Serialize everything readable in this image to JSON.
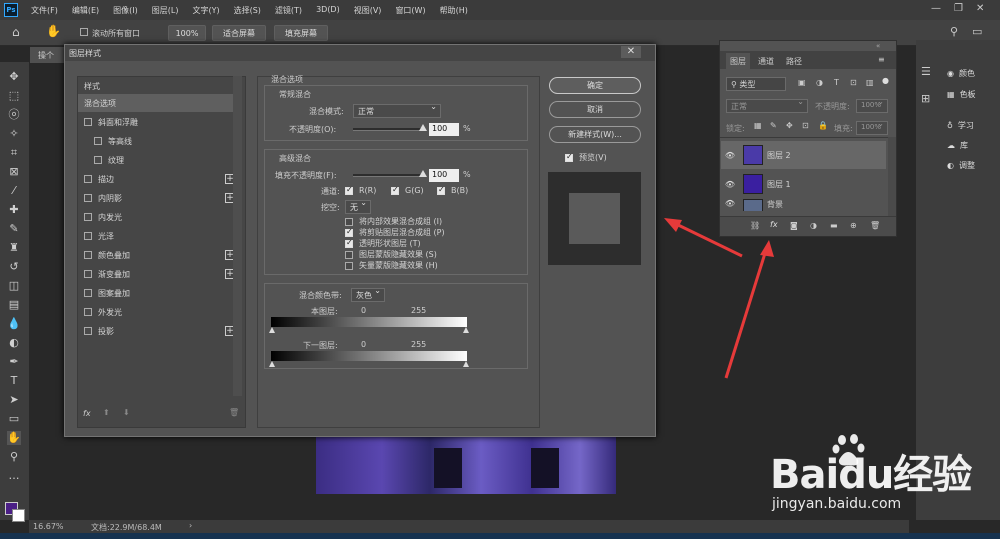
{
  "app": {
    "logo": "Ps"
  },
  "menu": [
    "文件(F)",
    "编辑(E)",
    "图像(I)",
    "图层(L)",
    "文字(Y)",
    "选择(S)",
    "滤镜(T)",
    "3D(D)",
    "视图(V)",
    "窗口(W)",
    "帮助(H)"
  ],
  "options": {
    "scroll_all": "滚动所有窗口",
    "zoom": "100%",
    "fit": "适合屏幕",
    "fill": "填充屏幕"
  },
  "doc_tab": "操个",
  "status": {
    "zoom": "16.67%",
    "doc": "文档:22.9M/68.4M"
  },
  "dialog": {
    "title": "图层样式",
    "styles_header": "样式",
    "styles": [
      {
        "label": "混合选项",
        "check": false,
        "plus": false,
        "selected": true
      },
      {
        "label": "斜面和浮雕",
        "check": true,
        "plus": false
      },
      {
        "label": "等高线",
        "check": true,
        "plus": false,
        "indent": true
      },
      {
        "label": "纹理",
        "check": true,
        "plus": false,
        "indent": true
      },
      {
        "label": "描边",
        "check": true,
        "plus": true
      },
      {
        "label": "内阴影",
        "check": true,
        "plus": true
      },
      {
        "label": "内发光",
        "check": true,
        "plus": false
      },
      {
        "label": "光泽",
        "check": true,
        "plus": false
      },
      {
        "label": "颜色叠加",
        "check": true,
        "plus": true
      },
      {
        "label": "渐变叠加",
        "check": true,
        "plus": true
      },
      {
        "label": "图案叠加",
        "check": true,
        "plus": false
      },
      {
        "label": "外发光",
        "check": true,
        "plus": false
      },
      {
        "label": "投影",
        "check": true,
        "plus": true
      }
    ],
    "fx": "fx",
    "main_title": "混合选项",
    "general": {
      "title": "常规混合",
      "mode_label": "混合模式:",
      "mode_value": "正常",
      "opacity_label": "不透明度(O):",
      "opacity_value": "100",
      "opacity": 1,
      "pct": "%"
    },
    "advanced": {
      "title": "高级混合",
      "fill_label": "填充不透明度(F):",
      "fill_value": "100",
      "fill": 1,
      "channels_label": "通道:",
      "r": "R(R)",
      "g": "G(G)",
      "b": "B(B)",
      "knockout_label": "挖空:",
      "knockout_value": "无",
      "options": [
        {
          "label": "将内部效果混合成组 (I)",
          "checked": false
        },
        {
          "label": "将剪贴图层混合成组 (P)",
          "checked": true
        },
        {
          "label": "透明形状图层 (T)",
          "checked": true
        },
        {
          "label": "图层蒙版隐藏效果 (S)",
          "checked": false
        },
        {
          "label": "矢量蒙版隐藏效果 (H)",
          "checked": false
        }
      ]
    },
    "blendif": {
      "label": "混合颜色带:",
      "value": "灰色",
      "this_layer": "本图层:",
      "under_layer": "下一图层:",
      "min": "0",
      "max": "255"
    },
    "buttons": {
      "ok": "确定",
      "cancel": "取消",
      "new_style": "新建样式(W)...",
      "preview": "预览(V)"
    }
  },
  "layers_panel": {
    "tabs": [
      "图层",
      "通道",
      "路径"
    ],
    "filter": "类型",
    "mode": "正常",
    "opacity_label": "不透明度:",
    "opacity_value": "100%",
    "lock_label": "锁定:",
    "fill_label": "填充:",
    "fill_value": "100%",
    "layers": [
      {
        "name": "图层 2",
        "selected": true,
        "thumb": "#4a3aa8"
      },
      {
        "name": "图层 1",
        "selected": false,
        "thumb": "#3a1fa0"
      },
      {
        "name": "背景",
        "selected": false,
        "thumb": "#5a6a8a"
      }
    ]
  },
  "dock": {
    "items": [
      "颜色",
      "色板",
      "学习",
      "库",
      "调整"
    ]
  },
  "colors": {
    "fg": "#4b1f86",
    "bg": "#ffffff",
    "arrow": "#e63a3a"
  },
  "watermark": {
    "brand": "Baidu经验",
    "url": "jingyan.baidu.com"
  }
}
